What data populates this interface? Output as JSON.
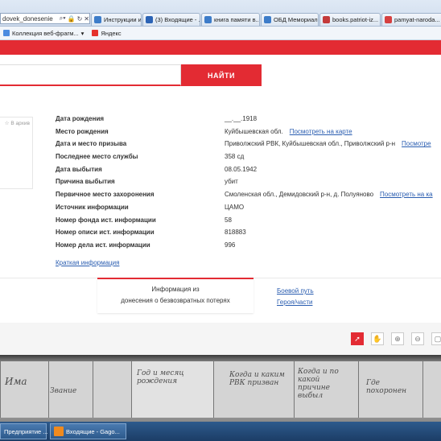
{
  "browser": {
    "address_text": "dovek_donesenie",
    "tabs": [
      {
        "label": "Инструкции и ...",
        "color": "#3d7cc9"
      },
      {
        "label": "(3) Входящие - ...",
        "color": "#2b63b5"
      },
      {
        "label": "книга памяти в...",
        "color": "#3d7cc9"
      },
      {
        "label": "ОБД Мемориал",
        "color": "#3d7cc9"
      },
      {
        "label": "books.patriot-iz...",
        "color": "#c43a3a"
      },
      {
        "label": "pamyat-naroda...",
        "color": "#d64040"
      }
    ],
    "favorites": [
      {
        "label": "Коллекция веб-фрагм...",
        "icon": "web-slice-icon",
        "color": "#4b8be0"
      },
      {
        "label": "Яндекс",
        "icon": "yandex-icon",
        "color": "#e5322d"
      }
    ]
  },
  "search": {
    "button_label": "НАЙТИ"
  },
  "card": {
    "rating_label": "☆ В архив"
  },
  "info": {
    "rows": [
      {
        "label": "Дата рождения",
        "value": "__.__.1918",
        "link": ""
      },
      {
        "label": "Место рождения",
        "value": "Куйбышевская обл.",
        "link": "Посмотреть на карте"
      },
      {
        "label": "Дата и место призыва",
        "value": "Приволжский РВК, Куйбышевская обл., Приволжский р-н",
        "link": "Посмотре"
      },
      {
        "label": "Последнее место службы",
        "value": "358 сд",
        "link": ""
      },
      {
        "label": "Дата выбытия",
        "value": "08.05.1942",
        "link": ""
      },
      {
        "label": "Причина выбытия",
        "value": "убит",
        "link": ""
      },
      {
        "label": "Первичное место захоронения",
        "value": "Смоленская обл., Демидовский р-н, д. Полуяново",
        "link": "Посмотреть на ка"
      },
      {
        "label": "Источник информации",
        "value": "ЦАМО",
        "link": ""
      },
      {
        "label": "Номер фонда ист. информации",
        "value": "58",
        "link": ""
      },
      {
        "label": "Номер описи ист. информации",
        "value": "818883",
        "link": ""
      },
      {
        "label": "Номер дела ист. информации",
        "value": "996",
        "link": ""
      }
    ],
    "brief_link": "Краткая информация"
  },
  "tabs_section": {
    "active_tab_line1": "Информация из",
    "active_tab_line2": "донесения о безвозвратных потерях",
    "links": [
      "Боевой путь",
      "Героя/части"
    ]
  },
  "viewer": {
    "tools": [
      "pointer-icon",
      "hand-icon",
      "zoom-in-icon",
      "zoom-out-icon",
      "fit-icon"
    ]
  },
  "document_text": [
    "Има",
    "Звание",
    "Год и месяц рождения",
    "Когда и каким РВК призван",
    "Когда и по какой причине выбыл",
    "Где похоронен"
  ],
  "taskbar": {
    "items": [
      {
        "label": "Предприятие ...",
        "icon": "app-icon"
      },
      {
        "label": "Входящие - Gago...",
        "icon": "outlook-icon"
      }
    ]
  }
}
